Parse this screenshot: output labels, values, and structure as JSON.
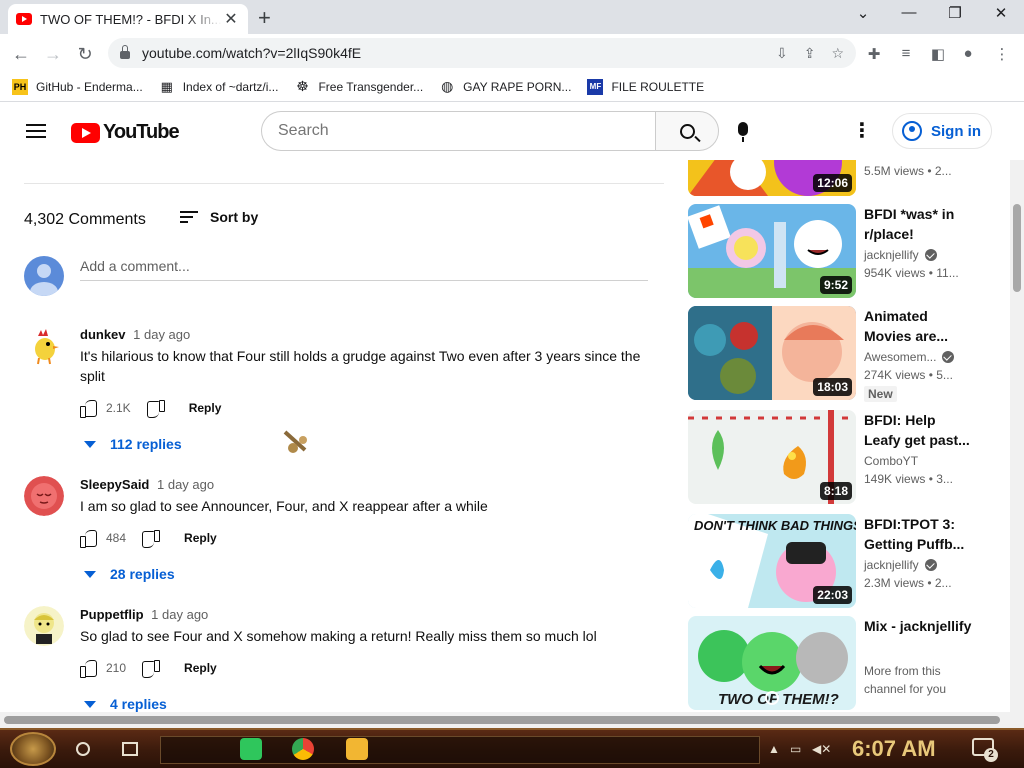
{
  "browser": {
    "tab_title": "TWO OF THEM!? - BFDI X In...",
    "tab_close": "✕",
    "new_tab": "+",
    "url": "youtube.com/watch?v=2lIqS90k4fE",
    "window_controls": [
      "⌄",
      "—",
      "❐",
      "✕"
    ],
    "bookmarks": [
      {
        "icon_text": "PH",
        "label": "GitHub - Enderma...",
        "icon_color": "#f7c31a"
      },
      {
        "icon_text": "▦",
        "label": "Index of ~dartz/i...",
        "icon_color": "#3c4043"
      },
      {
        "icon_text": "☸",
        "label": "Free Transgender...",
        "icon_color": "#3c4043"
      },
      {
        "icon_text": "◍",
        "label": "GAY RAPE PORN...",
        "icon_color": "#3c4043"
      },
      {
        "icon_text": "MF",
        "label": "FILE ROULETTE",
        "icon_color": "#1a3aa8"
      }
    ]
  },
  "youtube": {
    "logo_text": "YouTube",
    "search_placeholder": "Search",
    "signin_label": "Sign in"
  },
  "comments_section": {
    "count_label": "4,302 Comments",
    "sort_label": "Sort by",
    "add_comment_placeholder": "Add a comment...",
    "comments": [
      {
        "author": "dunkev",
        "time": "1 day ago",
        "text": "It's hilarious to know that Four still holds a grudge against Two even after 3 years since the split",
        "likes": "2.1K",
        "reply_label": "Reply",
        "replies_label": "112 replies",
        "avatar_color": "#f4d23c"
      },
      {
        "author": "SleepySaid",
        "time": "1 day ago",
        "text": "I am so glad to see Announcer, Four, and X reappear after a while",
        "likes": "484",
        "reply_label": "Reply",
        "replies_label": "28 replies",
        "avatar_color": "#e05050"
      },
      {
        "author": "Puppetflip",
        "time": "1 day ago",
        "text": "So glad to see Four and X somehow making a return! Really miss them so much lol",
        "likes": "210",
        "reply_label": "Reply",
        "replies_label": "4 replies",
        "avatar_color": "#efe68a"
      }
    ]
  },
  "recommendations": [
    {
      "title": "",
      "channel": "",
      "meta": "5.5M views  • 2...",
      "duration": "12:06",
      "verified": false,
      "badge": ""
    },
    {
      "title": "BFDI *was* in r/place!",
      "channel": "jacknjellify",
      "meta": "954K views  • 11...",
      "duration": "9:52",
      "verified": true,
      "badge": ""
    },
    {
      "title": "Animated Movies are...",
      "channel": "Awesomem...",
      "meta": "274K views  • 5...",
      "duration": "18:03",
      "verified": true,
      "badge": "New"
    },
    {
      "title": "BFDI: Help Leafy get past...",
      "channel": "ComboYT",
      "meta": "149K views  • 3...",
      "duration": "8:18",
      "verified": false,
      "badge": ""
    },
    {
      "title": "BFDI:TPOT 3: Getting Puffb...",
      "channel": "jacknjellify",
      "meta": "2.3M views  • 2...",
      "duration": "22:03",
      "verified": true,
      "badge": ""
    },
    {
      "title": "Mix - jacknjellify",
      "channel": "More from this channel for you",
      "meta": "",
      "duration": "",
      "verified": false,
      "badge": ""
    }
  ],
  "thumbnail_text": {
    "rplace": "r/place",
    "dont_think": "DON'T THINK BAD THINGS",
    "two_of_them": "TWO OF THEM!?"
  },
  "taskbar": {
    "clock": "6:07 AM",
    "notification_count": "2"
  }
}
